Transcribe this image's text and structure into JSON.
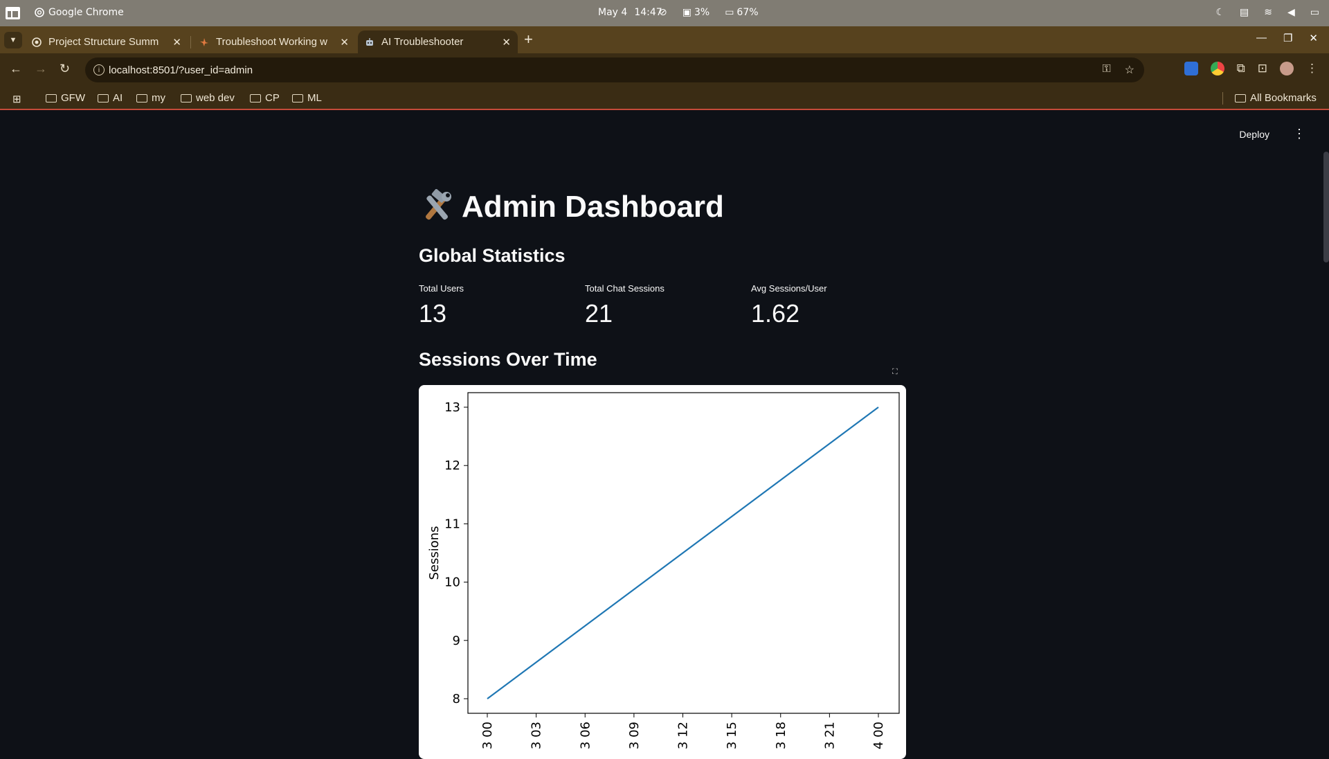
{
  "os": {
    "app_name": "Google Chrome",
    "date": "May 4",
    "time": "14:47",
    "cpu": "3%",
    "battery": "67%"
  },
  "tabs": [
    {
      "title": "Project Structure Summ",
      "active": false
    },
    {
      "title": "Troubleshoot Working w",
      "active": false
    },
    {
      "title": "AI Troubleshooter",
      "active": true
    }
  ],
  "address": {
    "url": "localhost:8501/?user_id=admin"
  },
  "bookmarks": {
    "items": [
      "GFW",
      "AI",
      "my",
      "web dev",
      "CP",
      "ML"
    ],
    "all_label": "All Bookmarks"
  },
  "header": {
    "deploy_label": "Deploy"
  },
  "dashboard": {
    "title": "Admin Dashboard",
    "stats_heading": "Global Statistics",
    "metrics": [
      {
        "label": "Total Users",
        "value": "13"
      },
      {
        "label": "Total Chat Sessions",
        "value": "21"
      },
      {
        "label": "Avg Sessions/User",
        "value": "1.62"
      }
    ],
    "chart_heading": "Sessions Over Time"
  },
  "chart_data": {
    "type": "line",
    "ylabel": "Sessions",
    "x": [
      "3 00",
      "3 03",
      "3 06",
      "3 09",
      "3 12",
      "3 15",
      "3 18",
      "3 21",
      "4 00"
    ],
    "x_ticks": [
      "3 00",
      "3 03",
      "3 06",
      "3 09",
      "3 12",
      "3 15",
      "3 18",
      "3 21",
      "4 00"
    ],
    "series": [
      {
        "points": [
          [
            0,
            8
          ],
          [
            8,
            13
          ]
        ],
        "color": "#1f77b4"
      }
    ],
    "y_ticks": [
      8,
      9,
      10,
      11,
      12,
      13
    ],
    "ylim": [
      7.75,
      13.25
    ],
    "grid": false
  }
}
